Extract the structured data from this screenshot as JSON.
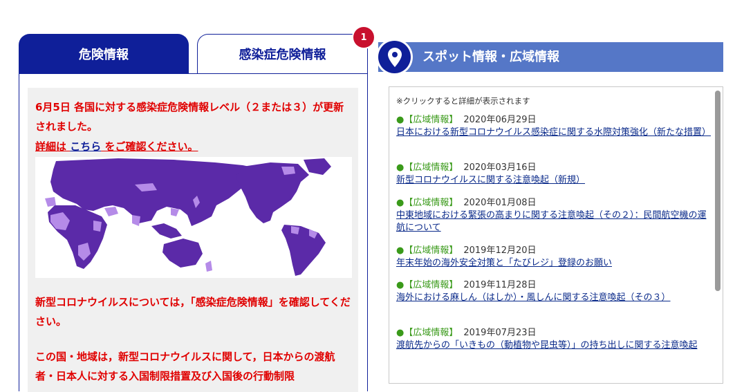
{
  "tabs": {
    "danger_label": "危険情報",
    "infection_label": "感染症危険情報",
    "badge_count": "1"
  },
  "notice": {
    "line1": "6月5日 各国に対する感染症危険情報レベル（２または３）が更新されました。",
    "detail_prefix": "詳細は ",
    "detail_link": "こちら",
    "detail_suffix": " をご確認ください。",
    "line2": "新型コロナウイルスについては，「感染症危険情報」を確認してください。",
    "line3": "この国・地域は，新型コロナウイルスに関して，日本からの渡航者・日本人に対する入国制限措置及び入国後の行動制限"
  },
  "spot": {
    "header_title": "スポット情報・広域情報",
    "note": "※クリックすると詳細が表示されます",
    "items": [
      {
        "tag": "【広域情報】",
        "date": "2020年06月29日",
        "title": "日本における新型コロナウイルス感染症に関する水際対策強化（新たな措置）"
      },
      {
        "tag": "【広域情報】",
        "date": "2020年03月16日",
        "title": "新型コロナウイルスに関する注意喚起（新規）"
      },
      {
        "tag": "【広域情報】",
        "date": "2020年01月08日",
        "title": "中東地域における緊張の高まりに関する注意喚起（その２）：民間航空機の運航について"
      },
      {
        "tag": "【広域情報】",
        "date": "2019年12月20日",
        "title": "年末年始の海外安全対策と「たびレジ」登録のお願い"
      },
      {
        "tag": "【広域情報】",
        "date": "2019年11月28日",
        "title": "海外における麻しん（はしか）・風しんに関する注意喚起（その３）"
      },
      {
        "tag": "【広域情報】",
        "date": "2019年07月23日",
        "title": "渡航先からの「いきもの（動植物や昆虫等）」の持ち出しに関する注意喚起"
      }
    ]
  },
  "colors": {
    "tab_active": "#0f1f99",
    "alert_red": "#e00000",
    "header_blue": "#5577c7",
    "map_dark": "#5b2aa8",
    "map_light": "#b58be8"
  },
  "icons": {
    "badge": "notification-badge",
    "pin": "map-pin-icon",
    "bullet": "bullet-dot-icon"
  }
}
